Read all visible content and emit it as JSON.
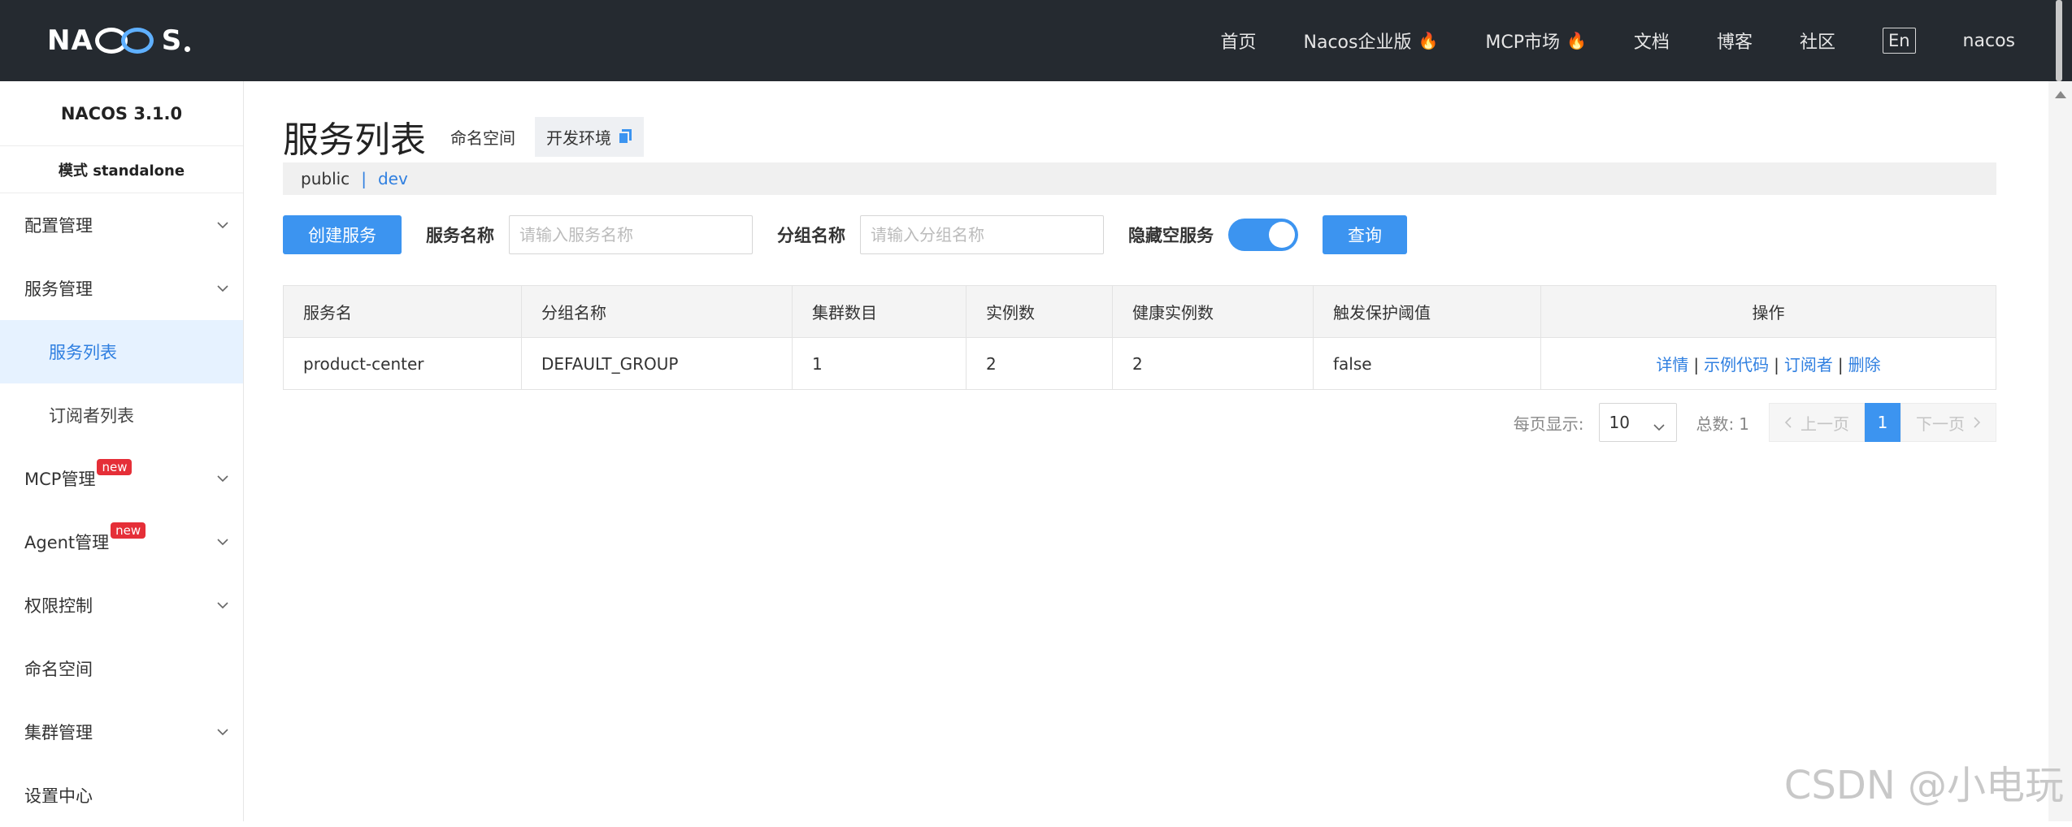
{
  "header": {
    "logo_text": "NACOS.",
    "nav": [
      {
        "label": "首页",
        "hot": false
      },
      {
        "label": "Nacos企业版",
        "hot": true
      },
      {
        "label": "MCP市场",
        "hot": true
      },
      {
        "label": "文档",
        "hot": false
      },
      {
        "label": "博客",
        "hot": false
      },
      {
        "label": "社区",
        "hot": false
      }
    ],
    "lang_button": "En",
    "user": "nacos"
  },
  "sidebar": {
    "version": "NACOS 3.1.0",
    "mode": "模式 standalone",
    "items": [
      {
        "label": "配置管理",
        "expandable": true
      },
      {
        "label": "服务管理",
        "expandable": true
      },
      {
        "label": "服务列表",
        "sub": true,
        "active": true
      },
      {
        "label": "订阅者列表",
        "sub": true
      },
      {
        "label": "MCP管理",
        "expandable": true,
        "badge": "new"
      },
      {
        "label": "Agent管理",
        "expandable": true,
        "badge": "new"
      },
      {
        "label": "权限控制",
        "expandable": true
      },
      {
        "label": "命名空间",
        "expandable": false
      },
      {
        "label": "集群管理",
        "expandable": true
      },
      {
        "label": "设置中心",
        "expandable": false
      }
    ]
  },
  "main": {
    "title": "服务列表",
    "namespace_label": "命名空间",
    "namespace_value": "开发环境",
    "ns_bar": {
      "public": "public",
      "separator": "|",
      "dev": "dev"
    },
    "filters": {
      "create_button": "创建服务",
      "service_name_label": "服务名称",
      "service_name_placeholder": "请输入服务名称",
      "service_name_value": "",
      "group_name_label": "分组名称",
      "group_name_placeholder": "请输入分组名称",
      "group_name_value": "",
      "hide_empty_label": "隐藏空服务",
      "hide_empty_on": true,
      "query_button": "查询"
    },
    "table": {
      "columns": [
        "服务名",
        "分组名称",
        "集群数目",
        "实例数",
        "健康实例数",
        "触发保护阈值",
        "操作"
      ],
      "rows": [
        {
          "service": "product-center",
          "group": "DEFAULT_GROUP",
          "clusters": "1",
          "instances": "2",
          "healthy": "2",
          "threshold": "false",
          "actions": [
            "详情",
            "示例代码",
            "订阅者",
            "删除"
          ]
        }
      ]
    },
    "pagination": {
      "page_size_label": "每页显示:",
      "page_size": "10",
      "total_label": "总数:",
      "total": "1",
      "prev": "上一页",
      "current": "1",
      "next": "下一页"
    }
  },
  "watermark": "CSDN @小电玩",
  "colors": {
    "header_bg": "#252a30",
    "primary": "#3c94f0",
    "link": "#2f7fe0",
    "active_bg": "#e6f2ff",
    "badge": "#e52f38"
  }
}
